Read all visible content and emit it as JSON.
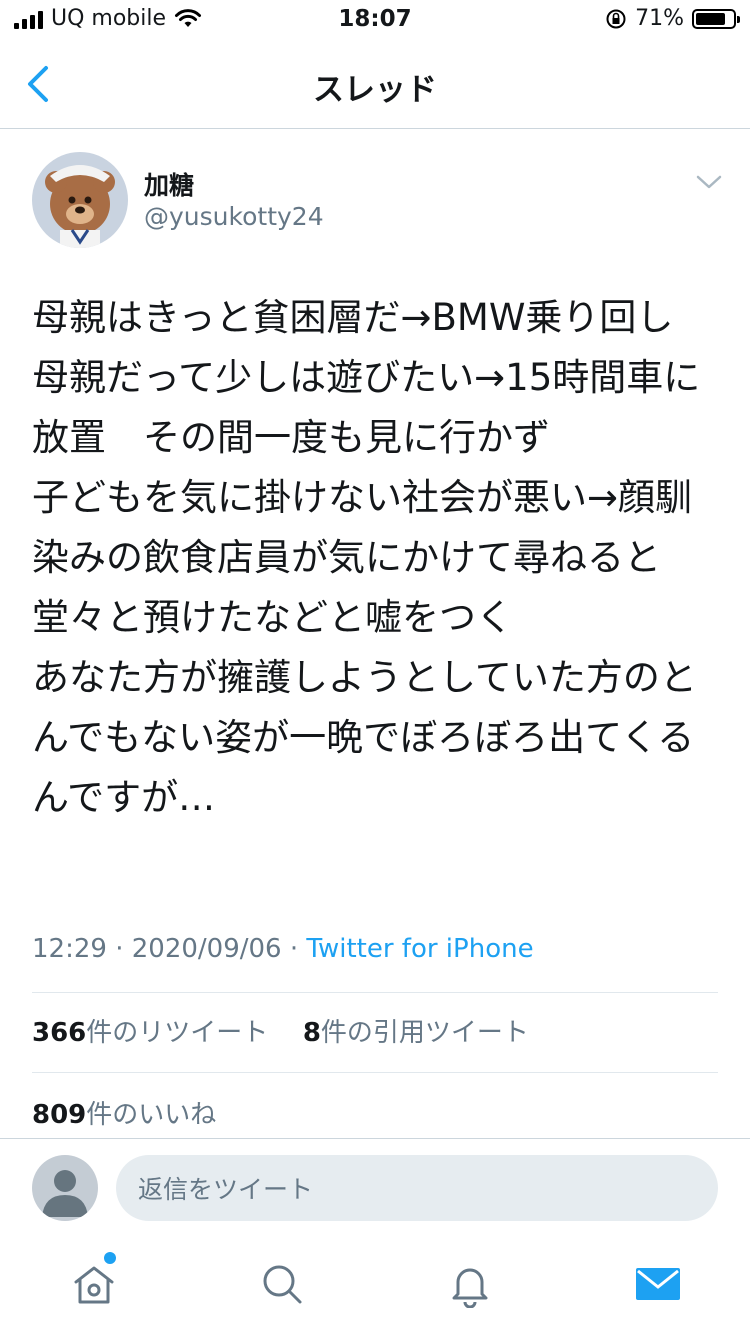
{
  "status_bar": {
    "carrier": "UQ mobile",
    "time": "18:07",
    "battery": "71%",
    "battery_level": 0.71
  },
  "nav": {
    "title": "スレッド",
    "back_icon": "chevron-left-icon"
  },
  "author": {
    "name": "加糖",
    "handle": "@yusukotty24",
    "avatar": "teddy-bear-sailor-avatar"
  },
  "tweet": {
    "text": "母親はきっと貧困層だ→BMW乗り回し\n母親だって少しは遊びたい→15時間車に放置　その間一度も見に行かず\n子どもを気に掛けない社会が悪い→顔馴染みの飲食店員が気にかけて尋ねると堂々と預けたなどと嘘をつく\nあなた方が擁護しようとしていた方のとんでもない姿が一晩でぼろぼろ出てくるんですが…",
    "time": "12:29",
    "sep1": " · ",
    "date": "2020/09/06",
    "sep2": " · ",
    "source": "Twitter for iPhone"
  },
  "stats": {
    "retweets_count": "366",
    "retweets_label": "件のリツイート",
    "quotes_count": "8",
    "quotes_label": "件の引用ツイート",
    "likes_count": "809",
    "likes_label": "件のいいね"
  },
  "reply": {
    "placeholder": "返信をツイート"
  },
  "tabs": [
    "home-icon",
    "search-icon",
    "bell-icon",
    "mail-icon"
  ],
  "colors": {
    "accent": "#1da1f2",
    "secondary_text": "#657786",
    "divider": "#e1e8ed"
  }
}
